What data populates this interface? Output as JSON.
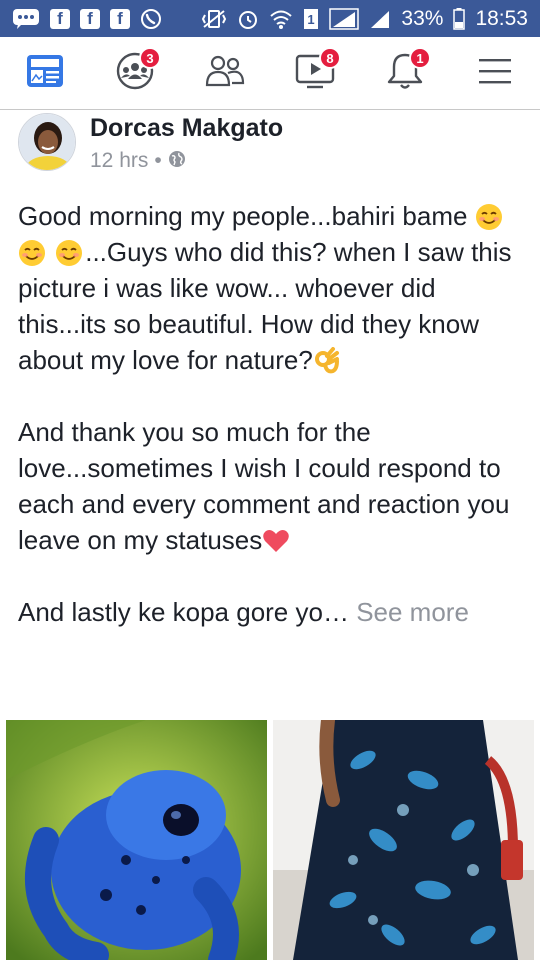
{
  "status_bar": {
    "battery": "33%",
    "time": "18:53",
    "left_icons": [
      "chat-icon",
      "facebook-icon",
      "facebook-icon",
      "facebook-icon",
      "whatsapp-icon"
    ],
    "right_icons": [
      "vibrate-icon",
      "alarm-icon",
      "wifi-icon",
      "sim1-icon",
      "signal-icon",
      "signal-icon",
      "battery-icon"
    ]
  },
  "nav": {
    "items": [
      {
        "name": "news-feed",
        "icon": "news-feed-icon",
        "badge": ""
      },
      {
        "name": "groups",
        "icon": "groups-icon",
        "badge": "3"
      },
      {
        "name": "friends",
        "icon": "friends-icon",
        "badge": ""
      },
      {
        "name": "watch",
        "icon": "video-icon",
        "badge": "8"
      },
      {
        "name": "notifications",
        "icon": "bell-icon",
        "badge": "1"
      },
      {
        "name": "menu",
        "icon": "hamburger-icon",
        "badge": ""
      }
    ]
  },
  "post": {
    "author": "Dorcas Makgato",
    "time": "12 hrs",
    "dot": "•",
    "privacy_icon": "globe-icon",
    "p1_a": "Good morning my people...bahiri bame ",
    "p1_b": "...Guys who did this? when I saw this picture i was like wow... whoever did this...its so beautiful. How did they know about my love for nature?",
    "p2": "And thank you so much for the love...sometimes I wish I could respond to each and every comment and reaction you leave on my statuses",
    "p3": "And lastly ke kopa gore yo… ",
    "see_more": "See more"
  },
  "colors": {
    "status_bar": "#3b5998",
    "nav_icon": "#4b4f56",
    "active_icon": "#3578e5",
    "badge": "#e41e3f",
    "text": "#1d2129",
    "muted": "#90949c"
  }
}
